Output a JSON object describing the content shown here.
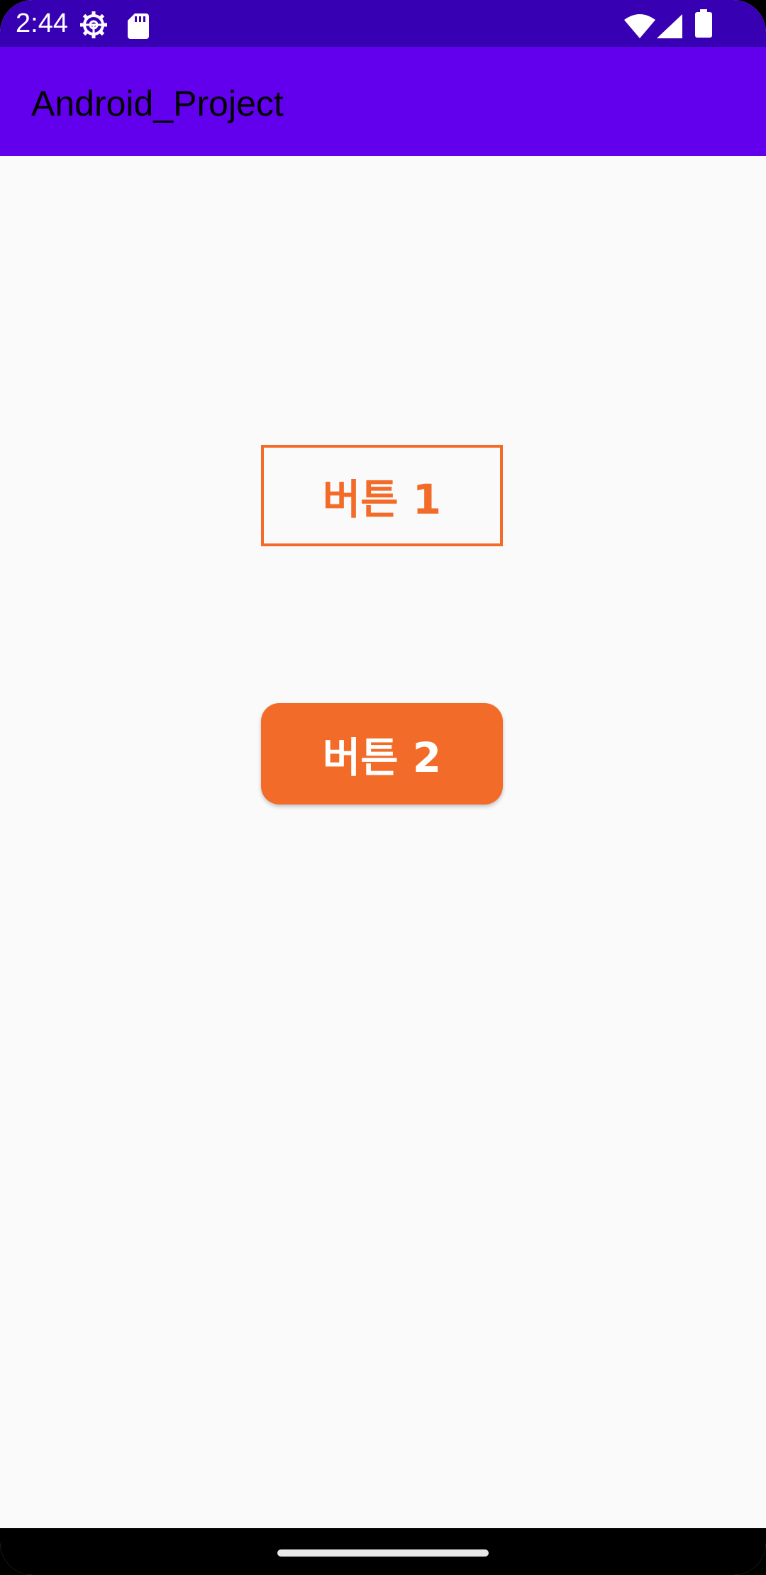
{
  "status_bar": {
    "time": "2:44",
    "icons": [
      "settings-gear-icon",
      "sd-card-icon",
      "wifi-icon",
      "cell-signal-icon",
      "battery-icon"
    ]
  },
  "app_bar": {
    "title": "Android_Project"
  },
  "buttons": {
    "button1_label": "버튼 1",
    "button2_label": "버튼 2"
  },
  "colors": {
    "status_bar": "#3700b3",
    "app_bar": "#6200ee",
    "accent_orange": "#f26b28",
    "background": "#fafafa"
  }
}
